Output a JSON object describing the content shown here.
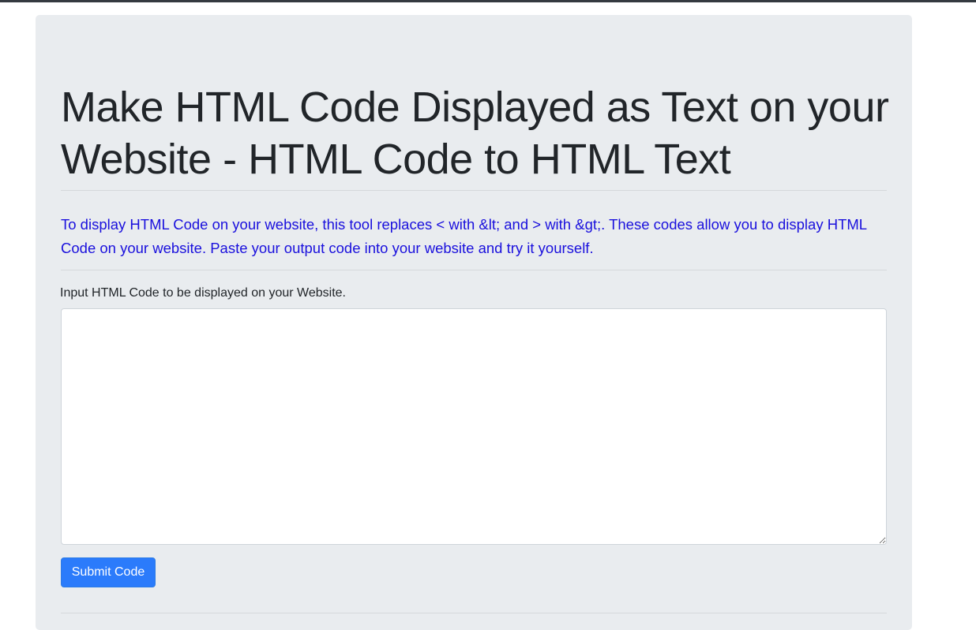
{
  "page": {
    "title": "Make HTML Code Displayed as Text on your Website - HTML Code to HTML Text",
    "description": "To display HTML Code on your website, this tool replaces < with &lt; and > with &gt;. These codes allow you to display HTML Code on your website. Paste your output code into your website and try it yourself."
  },
  "form": {
    "input_label": "Input HTML Code to be displayed on your Website.",
    "input_value": "",
    "submit_label": "Submit Code"
  },
  "colors": {
    "accent": "#2b7bfb",
    "lead_text": "#1a10dd",
    "panel_background": "#e9ecef"
  }
}
